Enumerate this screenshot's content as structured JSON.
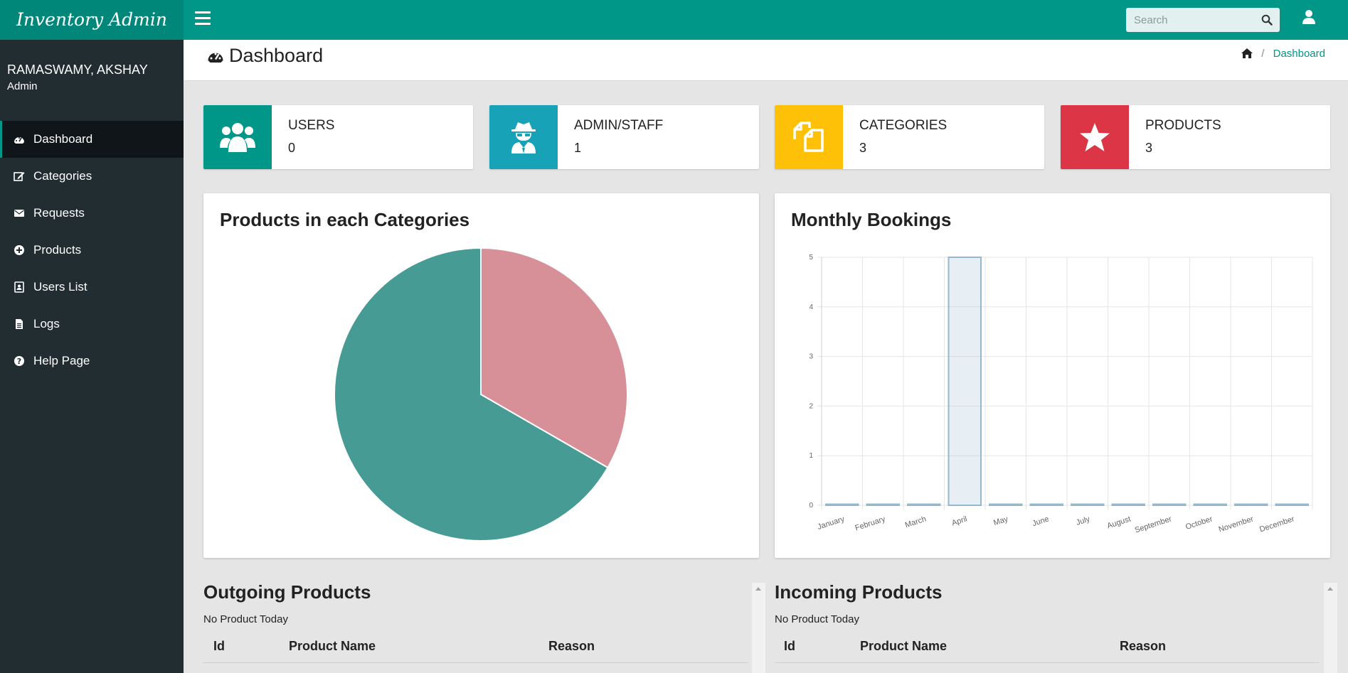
{
  "app": {
    "brand": "Inventory Admin"
  },
  "topbar": {
    "search_placeholder": "Search"
  },
  "profile": {
    "name": "RAMASWAMY, AKSHAY",
    "role": "Admin"
  },
  "sidebar": {
    "items": [
      {
        "label": "Dashboard",
        "icon": "dashboard-icon",
        "active": true
      },
      {
        "label": "Categories",
        "icon": "edit-icon"
      },
      {
        "label": "Requests",
        "icon": "envelope-icon"
      },
      {
        "label": "Products",
        "icon": "plus-circle-icon"
      },
      {
        "label": "Users List",
        "icon": "address-book-icon"
      },
      {
        "label": "Logs",
        "icon": "file-icon"
      },
      {
        "label": "Help Page",
        "icon": "question-circle-icon"
      }
    ]
  },
  "header": {
    "title": "Dashboard",
    "breadcrumb": "Dashboard"
  },
  "stats": [
    {
      "label": "USERS",
      "value": "0",
      "color": "#009688",
      "icon": "users-icon"
    },
    {
      "label": "ADMIN/STAFF",
      "value": "1",
      "color": "#17a2b8",
      "icon": "user-secret-icon"
    },
    {
      "label": "CATEGORIES",
      "value": "3",
      "color": "#ffc107",
      "icon": "copy-icon"
    },
    {
      "label": "PRODUCTS",
      "value": "3",
      "color": "#dc3545",
      "icon": "star-icon"
    }
  ],
  "panels": {
    "pie_title": "Products in each Categories",
    "bar_title": "Monthly Bookings"
  },
  "chart_data": [
    {
      "type": "pie",
      "title": "Products in each Categories",
      "values": [
        1,
        2
      ],
      "colors": [
        "#d79098",
        "#469c94"
      ]
    },
    {
      "type": "bar",
      "title": "Monthly Bookings",
      "categories": [
        "January",
        "February",
        "March",
        "April",
        "May",
        "June",
        "July",
        "August",
        "September",
        "October",
        "November",
        "December"
      ],
      "values": [
        0,
        0,
        0,
        5,
        0,
        0,
        0,
        0,
        0,
        0,
        0,
        0
      ],
      "ylim": [
        0,
        5
      ],
      "yticks": [
        "0",
        "1",
        "2",
        "3",
        "4",
        "5"
      ],
      "grid": true
    }
  ],
  "outgoing": {
    "title": "Outgoing Products",
    "empty": "No Product Today",
    "columns": [
      "Id",
      "Product Name",
      "Reason"
    ]
  },
  "incoming": {
    "title": "Incoming Products",
    "empty": "No Product Today",
    "columns": [
      "Id",
      "Product Name",
      "Reason"
    ]
  }
}
